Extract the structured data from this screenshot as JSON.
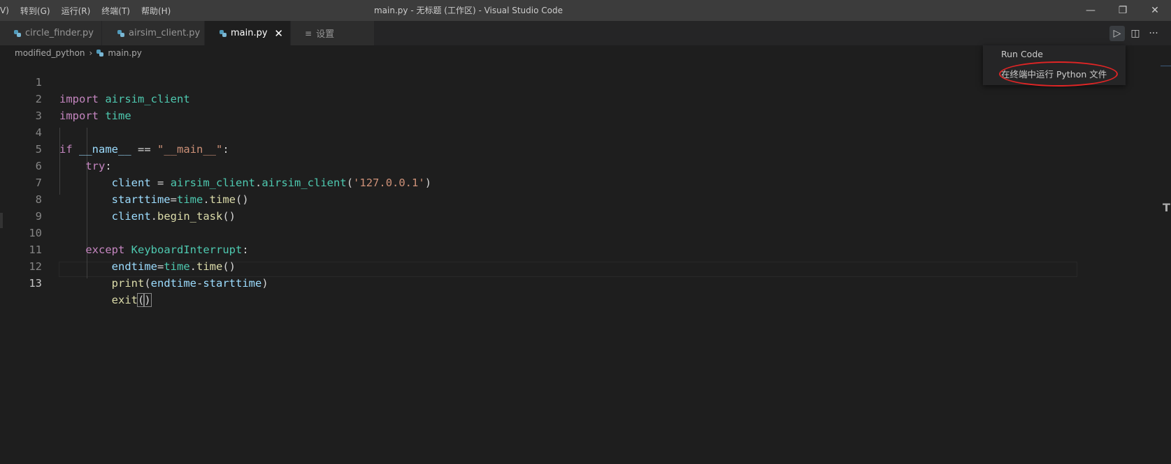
{
  "menu": {
    "items": [
      "V)",
      "转到(G)",
      "运行(R)",
      "终端(T)",
      "帮助(H)"
    ]
  },
  "window": {
    "title": "main.py - 无标题 (工作区) - Visual Studio Code",
    "minimize": "—",
    "restore": "❐",
    "close": "✕"
  },
  "tabs": [
    {
      "label": "circle_finder.py"
    },
    {
      "label": "airsim_client.py"
    },
    {
      "label": "main.py",
      "close": "✕"
    },
    {
      "label": "设置",
      "icon": "≡"
    }
  ],
  "editor_actions": {
    "run": "▷",
    "split": "◫",
    "more": "···"
  },
  "breadcrumb": {
    "folder": "modified_python",
    "sep": "›",
    "file": "main.py"
  },
  "dropdown": {
    "run_code": "Run Code",
    "run_in_terminal": "在终端中运行 Python 文件"
  },
  "code": {
    "line_numbers": [
      "1",
      "2",
      "3",
      "4",
      "5",
      "6",
      "7",
      "8",
      "9",
      "10",
      "11",
      "12",
      "13"
    ],
    "l1": {
      "kw": "import",
      "mod": "airsim_client"
    },
    "l2": {
      "kw": "import",
      "mod": "time"
    },
    "l4": {
      "kw": "if",
      "var": "__name__",
      "op": "==",
      "str": "\"__main__\"",
      "colon": ":"
    },
    "l5": {
      "kw": "try",
      "colon": ":"
    },
    "l6": {
      "var": "client",
      "op": "=",
      "mod": "airsim_client",
      "dot": ".",
      "fn": "airsim_client",
      "open": "(",
      "str": "'127.0.0.1'",
      "close": ")"
    },
    "l7": {
      "var": "starttime",
      "op": "=",
      "mod": "time",
      "dot": ".",
      "fn": "time",
      "parens": "()"
    },
    "l8": {
      "var": "client",
      "dot": ".",
      "fn": "begin_task",
      "parens": "()"
    },
    "l10": {
      "kw": "except",
      "mod": "KeyboardInterrupt",
      "colon": ":"
    },
    "l11": {
      "var": "endtime",
      "op": "=",
      "mod": "time",
      "dot": ".",
      "fn": "time",
      "parens": "()"
    },
    "l12": {
      "fn": "print",
      "open": "(",
      "var": "endtime",
      "minus": "-",
      "var2": "starttime",
      "close": ")"
    },
    "l13": {
      "fn": "exit",
      "open": "(",
      "close": ")"
    }
  },
  "scroll_marker": "T"
}
